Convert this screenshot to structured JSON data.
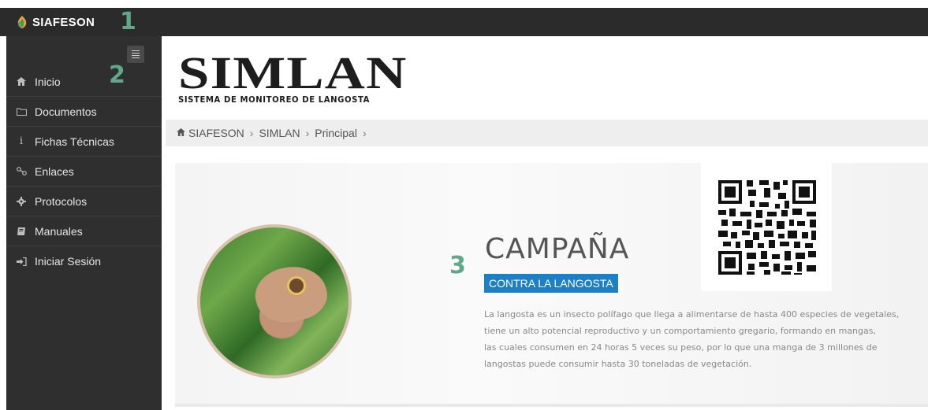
{
  "topbar": {
    "brand": "SIAFESON",
    "callout": "1"
  },
  "sidebar": {
    "callout": "2",
    "toggle_icon": "menu-icon",
    "items": [
      {
        "label": "Inicio",
        "icon": "home-icon"
      },
      {
        "label": "Documentos",
        "icon": "folder-icon"
      },
      {
        "label": "Fichas Técnicas",
        "icon": "info-icon"
      },
      {
        "label": "Enlaces",
        "icon": "link-icon"
      },
      {
        "label": "Protocolos",
        "icon": "gear-icon"
      },
      {
        "label": "Manuales",
        "icon": "book-icon"
      },
      {
        "label": "Iniciar Sesión",
        "icon": "sign-in-icon"
      }
    ]
  },
  "logo": {
    "title": "SIMLAN",
    "subtitle": "SISTEMA DE MONITOREO DE LANGOSTA"
  },
  "breadcrumb": {
    "items": [
      "SIAFESON",
      "SIMLAN",
      "Principal"
    ],
    "separator": "›"
  },
  "hero": {
    "callout": "3",
    "title": "CAMPAÑA",
    "tag": "CONTRA LA LANGOSTA",
    "description_lines": [
      "La langosta es un insecto polífago que llega a alimentarse de hasta 400 especies de vegetales,",
      "tiene un alto potencial reproductivo y un comportamiento gregario, formando en mangas,",
      "las cuales consumen en 24 horas 5 veces su peso, por lo que una manga de 3 millones de",
      "langostas puede consumir hasta 30 toneladas de vegetación."
    ]
  },
  "colors": {
    "topbar": "#2b2b2b",
    "sidebar": "#2f2f2f",
    "callout": "#5fa88a",
    "tag": "#1e7fc4",
    "breadcrumb_bg": "#eeeeee"
  }
}
